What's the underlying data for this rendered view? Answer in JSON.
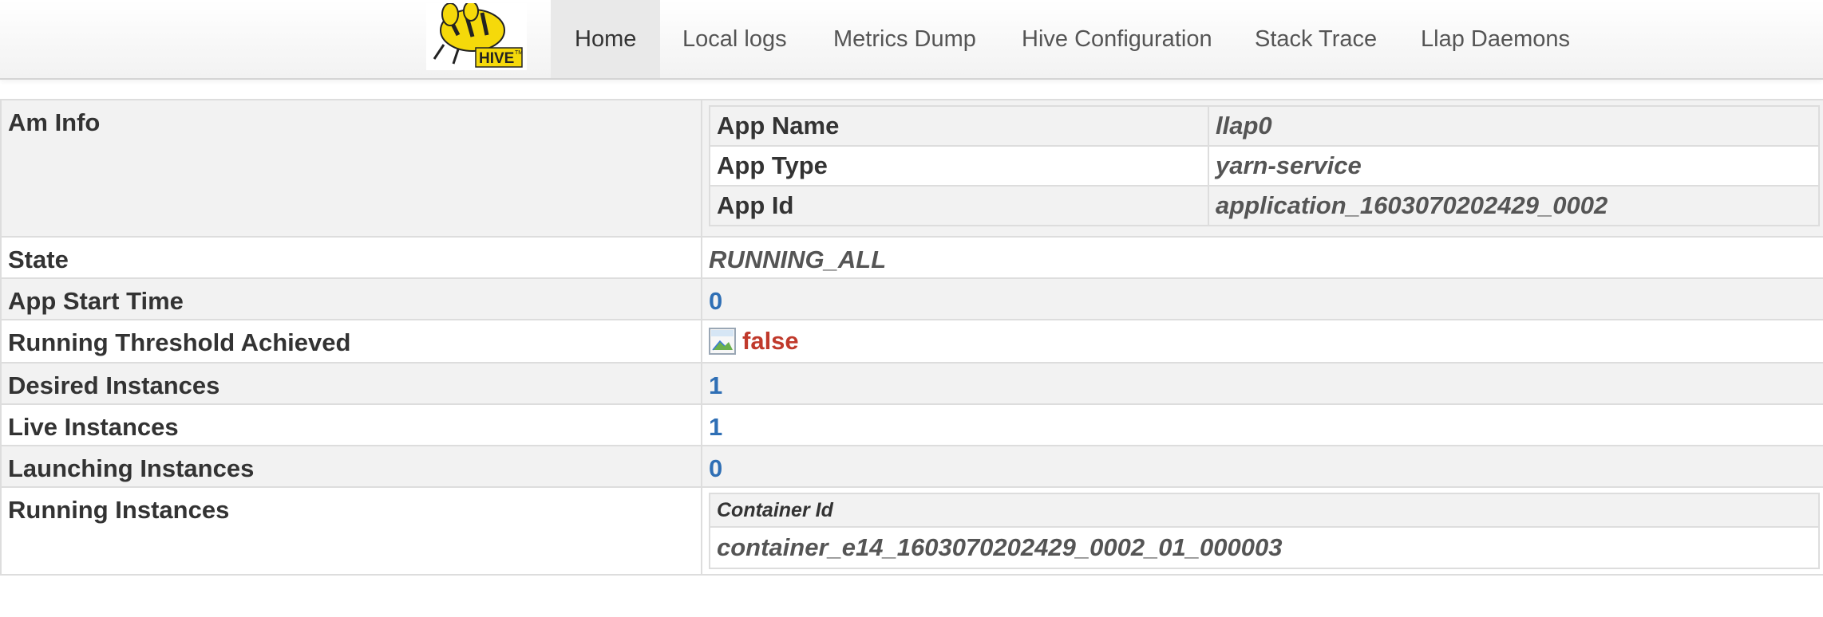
{
  "navbar": {
    "brand_alt": "HIVE",
    "items": [
      {
        "label": "Home",
        "active": true
      },
      {
        "label": "Local logs"
      },
      {
        "label": "Metrics Dump"
      },
      {
        "label": "Hive Configuration"
      },
      {
        "label": "Stack Trace"
      },
      {
        "label": "Llap Daemons"
      }
    ]
  },
  "am_info": {
    "label": "Am Info",
    "rows": [
      {
        "label": "App Name",
        "value": "llap0"
      },
      {
        "label": "App Type",
        "value": "yarn-service"
      },
      {
        "label": "App Id",
        "value": "application_1603070202429_0002"
      }
    ]
  },
  "state": {
    "label": "State",
    "value": "RUNNING_ALL"
  },
  "app_start_time": {
    "label": "App Start Time",
    "value": "0"
  },
  "running_threshold": {
    "label": "Running Threshold Achieved",
    "value": "false",
    "icon": "broken-image-icon"
  },
  "desired_instances": {
    "label": "Desired Instances",
    "value": "1"
  },
  "live_instances": {
    "label": "Live Instances",
    "value": "1"
  },
  "launching_instances": {
    "label": "Launching Instances",
    "value": "0"
  },
  "running_instances": {
    "label": "Running Instances",
    "header": "Container Id",
    "containers": [
      "container_e14_1603070202429_0002_01_000003"
    ]
  },
  "colors": {
    "number": "#2f6fb5",
    "false": "#c0392b",
    "row_stripe": "#f2f2f2",
    "border": "#dddddd",
    "logo_yellow": "#f5d90a"
  }
}
